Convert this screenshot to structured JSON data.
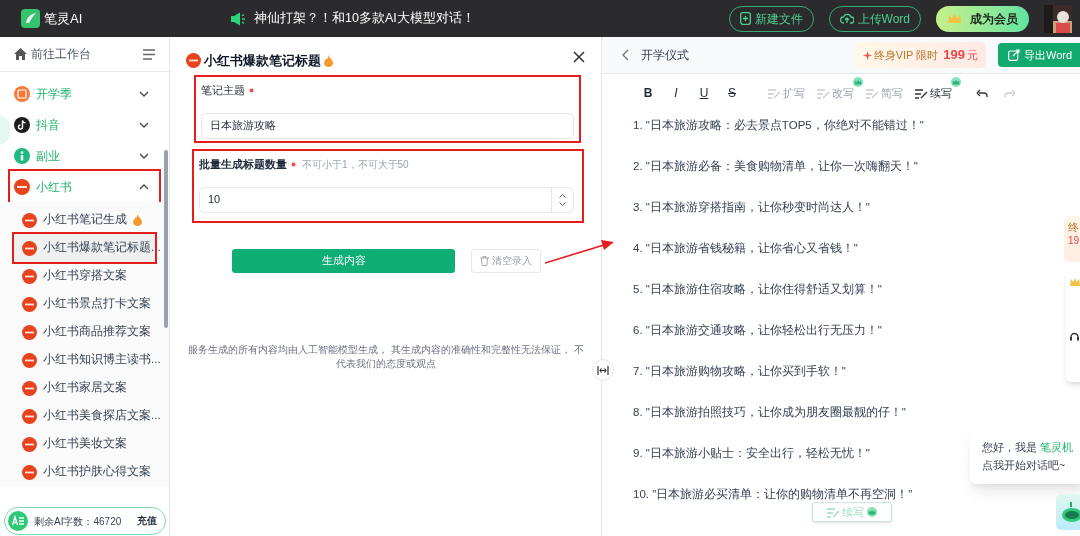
{
  "topbar": {
    "logo_text": "笔灵AI",
    "announcement": "神仙打架？！和10多款AI大模型对话！",
    "buttons": [
      {
        "label": "新建文件",
        "kind": "new"
      },
      {
        "label": "上传Word",
        "kind": "upload"
      }
    ],
    "member_button": "成为会员"
  },
  "sidebar": {
    "workbench": "前往工作台",
    "categories": [
      {
        "label": "开学季",
        "kind": "calendar",
        "expanded": false,
        "highlighted": false
      },
      {
        "label": "抖音",
        "kind": "tiktok",
        "expanded": false,
        "highlighted": false
      },
      {
        "label": "副业",
        "kind": "info",
        "expanded": false,
        "highlighted": false
      },
      {
        "label": "小红书",
        "kind": "xhs",
        "expanded": true,
        "highlighted": true,
        "children": [
          {
            "label": "小红书笔记生成",
            "hot": true,
            "selected": false,
            "highlighted": false
          },
          {
            "label": "小红书爆款笔记标题...",
            "hot": false,
            "selected": true,
            "highlighted": true
          },
          {
            "label": "小红书穿搭文案",
            "hot": false,
            "selected": false,
            "highlighted": false
          },
          {
            "label": "小红书景点打卡文案",
            "hot": false,
            "selected": false,
            "highlighted": false
          },
          {
            "label": "小红书商品推荐文案",
            "hot": false,
            "selected": false,
            "highlighted": false
          },
          {
            "label": "小红书知识博主读书...",
            "hot": false,
            "selected": false,
            "highlighted": false
          },
          {
            "label": "小红书家居文案",
            "hot": false,
            "selected": false,
            "highlighted": false
          },
          {
            "label": "小红书美食探店文案...",
            "hot": false,
            "selected": false,
            "highlighted": false
          },
          {
            "label": "小红书美妆文案",
            "hot": false,
            "selected": false,
            "highlighted": false
          },
          {
            "label": "小红书护肤心得文案",
            "hot": false,
            "selected": false,
            "highlighted": false
          }
        ]
      }
    ],
    "balance": "剩余AI字数：46720",
    "recharge": "充值"
  },
  "form": {
    "title": "小红书爆款笔记标题",
    "hot": true,
    "fields": [
      {
        "kind": "text",
        "label": "笔记主题",
        "required": true,
        "value": "日本旅游攻略",
        "highlighted": true
      },
      {
        "kind": "number",
        "label": "批量生成标题数量",
        "required": true,
        "hint": "不可小于1，不可大于50",
        "value": "10",
        "highlighted": true
      }
    ],
    "submit": "生成内容",
    "clear": "清空录入",
    "disclaimer": "服务生成的所有内容均由人工智能模型生成， 其生成内容的准确性和完整性无法保证， 不代表我们的态度或观点"
  },
  "editor": {
    "doc_title": "开学仪式",
    "promo": {
      "text": "终身VIP 限时",
      "price": "199",
      "unit": "元"
    },
    "export": "导出Word",
    "format_buttons": [
      {
        "label": "B",
        "kind": "bold"
      },
      {
        "label": "I",
        "kind": "italic"
      },
      {
        "label": "U",
        "kind": "underline"
      },
      {
        "label": "S",
        "kind": "strike"
      }
    ],
    "ai_tools": [
      {
        "label": "扩写",
        "premium": false,
        "disabled": true
      },
      {
        "label": "改写",
        "premium": true,
        "disabled": true
      },
      {
        "label": "简写",
        "premium": false,
        "disabled": true
      },
      {
        "label": "续写",
        "premium": true,
        "disabled": false
      }
    ],
    "redo_disabled": true,
    "lines": [
      "1. \"日本旅游攻略：必去景点TOP5，你绝对不能错过！\"",
      "2. \"日本旅游必备：美食购物清单，让你一次嗨翻天！\"",
      "3. \"日本旅游穿搭指南，让你秒变时尚达人！\"",
      "4. \"日本旅游省钱秘籍，让你省心又省钱！\"",
      "5. \"日本旅游住宿攻略，让你住得舒适又划算！\"",
      "6. \"日本旅游交通攻略，让你轻松出行无压力！\"",
      "7. \"日本旅游购物攻略，让你买到手软！\"",
      "8. \"日本旅游拍照技巧，让你成为朋友圈最靓的仔！\"",
      "9. \"日本旅游小贴士：安全出行，轻松无忧！\"",
      "10. \"日本旅游必买清单：让你的购物清单不再空洞！\""
    ],
    "float_button": {
      "label": "续写",
      "premium": true
    }
  },
  "side_widgets": {
    "promo_line": "终",
    "price": "19"
  },
  "chat": {
    "greeting": "您好，我是 ",
    "bot_name": "笔灵机",
    "prompt": "点我开始对话吧~"
  }
}
